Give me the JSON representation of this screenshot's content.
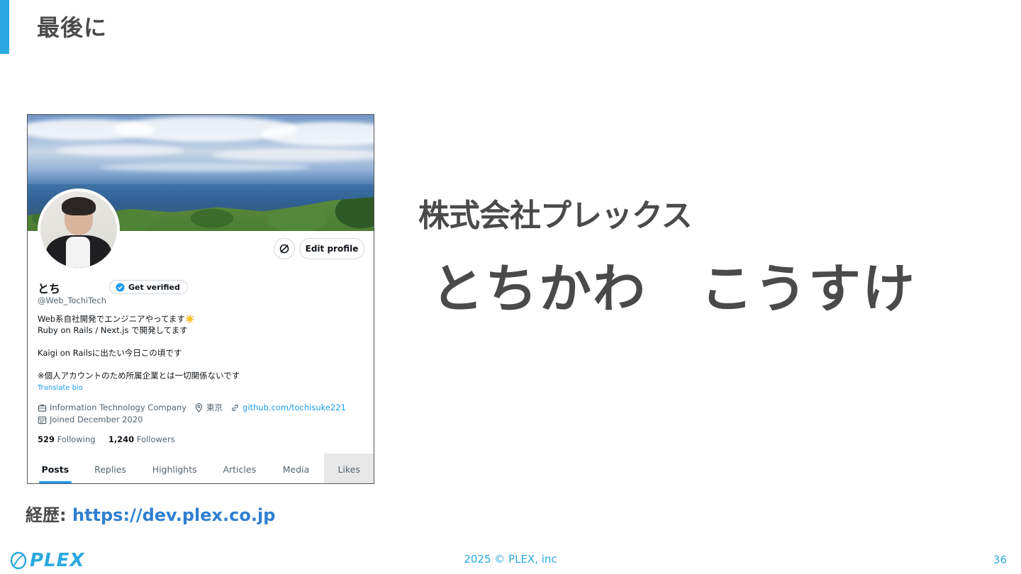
{
  "slide": {
    "title": "最後に",
    "career_label": "経歴:",
    "career_url": "https://dev.plex.co.jp",
    "company": "株式会社プレックス",
    "person_name": "とちかわ　こうすけ",
    "logo_text": "PLEX",
    "footer": "2025 © PLEX, inc",
    "page_number": "36",
    "accent_color": "#29a9e0"
  },
  "profile": {
    "edit_profile_label": "Edit profile",
    "display_name": "とち",
    "get_verified_label": "Get verified",
    "handle": "@Web_TochiTech",
    "bio_line1": "Web系自社開発でエンジニアやってます☀️",
    "bio_line2": "Ruby on Rails / Next.js で開発してます",
    "bio_line3": "Kaigi on Railsに出たい今日この頃です",
    "bio_line4": "※個人アカウントのため所属企業とは一切関係ないです",
    "translate_label": "Translate bio",
    "occupation": "Information Technology Company",
    "location": "東京",
    "website": "github.com/tochisuke221",
    "joined": "Joined December 2020",
    "following_count": "529",
    "following_label": "Following",
    "followers_count": "1,240",
    "followers_label": "Followers",
    "tabs": [
      "Posts",
      "Replies",
      "Highlights",
      "Articles",
      "Media",
      "Likes"
    ],
    "accent_color": "#1d9bf0"
  }
}
